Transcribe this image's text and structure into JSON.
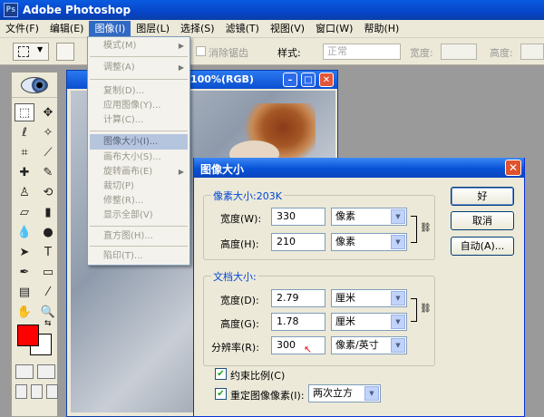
{
  "app": {
    "title": "Adobe Photoshop",
    "icon": "Ps"
  },
  "menubar": {
    "items": [
      "文件(F)",
      "编辑(E)",
      "图像(I)",
      "图层(L)",
      "选择(S)",
      "滤镜(T)",
      "视图(V)",
      "窗口(W)",
      "帮助(H)"
    ],
    "active_index": 2
  },
  "options": {
    "antialias_label": "消除锯齿",
    "style_label": "样式:",
    "style_value": "正常",
    "width_label": "宽度:",
    "height_label": "高度:"
  },
  "image_menu": {
    "items": [
      {
        "label": "模式(M)",
        "submenu": true
      },
      {
        "sep": true
      },
      {
        "label": "调整(A)",
        "submenu": true
      },
      {
        "sep": true
      },
      {
        "label": "复制(D)..."
      },
      {
        "label": "应用图像(Y)..."
      },
      {
        "label": "计算(C)..."
      },
      {
        "sep": true
      },
      {
        "label": "图像大小(I)...",
        "highlighted": true
      },
      {
        "label": "画布大小(S)..."
      },
      {
        "label": "旋转画布(E)",
        "submenu": true
      },
      {
        "label": "裁切(P)"
      },
      {
        "label": "修整(R)..."
      },
      {
        "label": "显示全部(V)"
      },
      {
        "sep": true
      },
      {
        "label": "直方图(H)..."
      },
      {
        "sep": true
      },
      {
        "label": "陷印(T)..."
      }
    ]
  },
  "document": {
    "title": "100%(RGB)"
  },
  "dialog": {
    "title": "图像大小",
    "pixel_group": {
      "title": "像素大小:203K",
      "width_label": "宽度(W):",
      "width_value": "330",
      "width_unit": "像素",
      "height_label": "高度(H):",
      "height_value": "210",
      "height_unit": "像素"
    },
    "doc_group": {
      "title": "文档大小:",
      "width_label": "宽度(D):",
      "width_value": "2.79",
      "width_unit": "厘米",
      "height_label": "高度(G):",
      "height_value": "1.78",
      "height_unit": "厘米",
      "res_label": "分辨率(R):",
      "res_value": "300",
      "res_unit": "像素/英寸"
    },
    "constrain_label": "约束比例(C)",
    "resample_label": "重定图像像素(I):",
    "resample_value": "两次立方",
    "buttons": {
      "ok": "好",
      "cancel": "取消",
      "auto": "自动(A)..."
    }
  },
  "colors": {
    "foreground": "#ff0000",
    "background": "#ffffff",
    "accent": "#316ac5"
  },
  "icons": [
    "marquee-icon",
    "move-icon",
    "lasso-icon",
    "magic-wand-icon",
    "crop-icon",
    "slice-icon",
    "healing-icon",
    "brush-icon",
    "stamp-icon",
    "history-brush-icon",
    "eraser-icon",
    "gradient-icon",
    "blur-icon",
    "dodge-icon",
    "path-select-icon",
    "type-icon",
    "pen-icon",
    "shape-icon",
    "notes-icon",
    "eyedropper-icon",
    "hand-icon",
    "zoom-icon"
  ]
}
